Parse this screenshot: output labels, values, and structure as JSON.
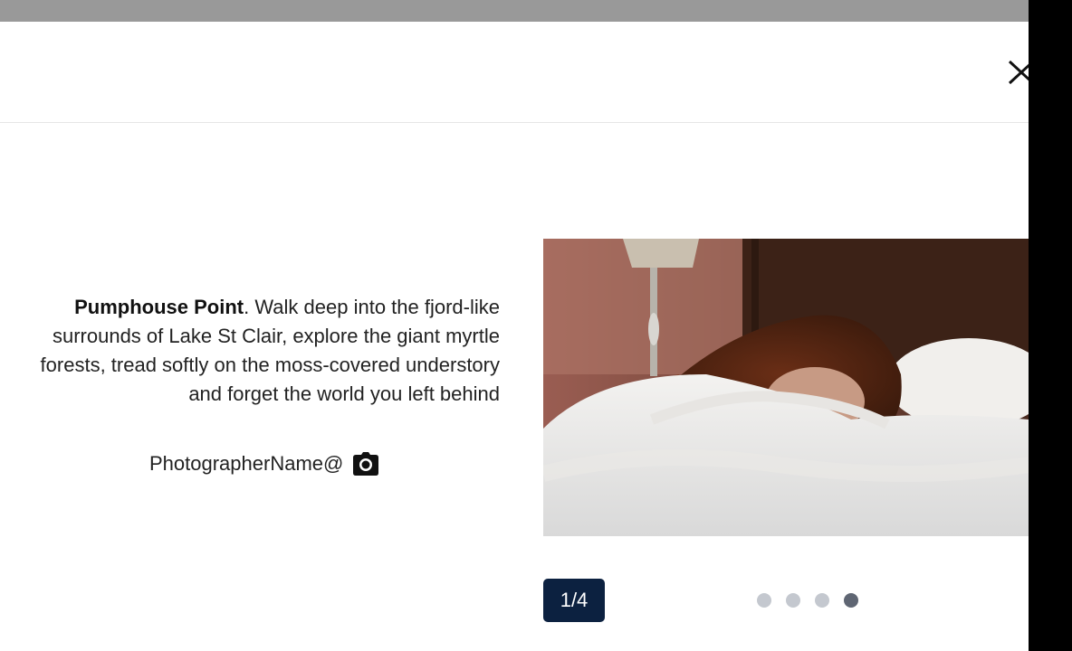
{
  "modal": {
    "close_icon": "close-icon"
  },
  "caption": {
    "title": "Pumphouse Point",
    "text": ". Walk deep into the fjord-like surrounds of Lake St Clair, explore the giant myrtle forests, tread softly on the moss-covered understory and forget the world you left behind"
  },
  "credit": {
    "photographer": "PhotographerName@",
    "icon": "camera-icon"
  },
  "carousel": {
    "counter": "1/4",
    "dots": 4,
    "active_dot": 4
  },
  "colors": {
    "counter_bg": "#0c2140",
    "dot_inactive": "#c4c8cf",
    "dot_active": "#5f6673"
  }
}
